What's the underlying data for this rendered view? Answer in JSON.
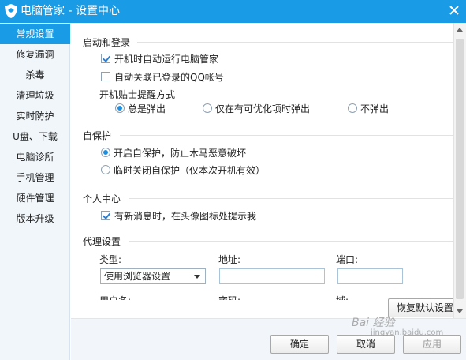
{
  "window": {
    "title": "电脑管家 - 设置中心",
    "logo_icon": "shield-logo-icon",
    "close_icon": "close-icon",
    "accent_color": "#1a9be6"
  },
  "sidebar": {
    "items": [
      {
        "label": "常规设置",
        "active": true
      },
      {
        "label": "修复漏洞"
      },
      {
        "label": "杀毒"
      },
      {
        "label": "清理垃圾"
      },
      {
        "label": "实时防护"
      },
      {
        "label": "U盘、下载"
      },
      {
        "label": "电脑诊所"
      },
      {
        "label": "手机管理"
      },
      {
        "label": "硬件管理"
      },
      {
        "label": "版本升级"
      }
    ]
  },
  "startup": {
    "title": "启动和登录",
    "auto_start": {
      "label": "开机时自动运行电脑管家",
      "checked": true
    },
    "auto_qq": {
      "label": "自动关联已登录的QQ帐号",
      "checked": false
    },
    "tips_label": "开机贴士提醒方式",
    "tips_options": [
      {
        "label": "总是弹出",
        "selected": true
      },
      {
        "label": "仅在有可优化项时弹出",
        "selected": false
      },
      {
        "label": "不弹出",
        "selected": false
      }
    ]
  },
  "self_protect": {
    "title": "自保护",
    "options": [
      {
        "label": "开启自保护，防止木马恶意破坏",
        "selected": true
      },
      {
        "label": "临时关闭自保护（仅本次开机有效）",
        "selected": false
      }
    ]
  },
  "personal": {
    "title": "个人中心",
    "notify": {
      "label": "有新消息时，在头像图标处提示我",
      "checked": true
    }
  },
  "proxy": {
    "title": "代理设置",
    "type_label": "类型:",
    "type_value": "使用浏览器设置",
    "address_label": "地址:",
    "address_value": "",
    "port_label": "端口:",
    "port_value": "",
    "username_label": "用户名:",
    "password_label": "密码:",
    "domain_label": "域:"
  },
  "buttons": {
    "restore_defaults": "恢复默认设置",
    "ok": "确定",
    "cancel": "取消",
    "apply": "应用"
  },
  "watermark": {
    "text": "Bai 经验",
    "sub": "jingyan.baidu.com"
  }
}
